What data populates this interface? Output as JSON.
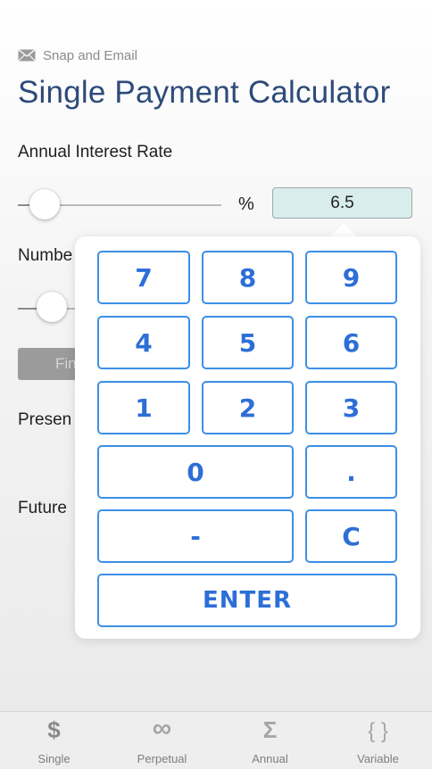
{
  "header": {
    "snap_email_label": "Snap and Email",
    "title": "Single Payment Calculator"
  },
  "interest": {
    "label": "Annual Interest Rate",
    "unit": "%",
    "value": "6.5"
  },
  "labels": {
    "number_partial": "Numbe",
    "button_partial": "Fin",
    "present_partial": "Presen",
    "future_partial": "Future"
  },
  "keypad": {
    "keys": [
      "7",
      "8",
      "9",
      "4",
      "5",
      "6",
      "1",
      "2",
      "3",
      "0",
      ".",
      "-",
      "C"
    ],
    "enter": "ENTER"
  },
  "tabs": [
    {
      "icon": "$",
      "label": "Single"
    },
    {
      "icon": "∞",
      "label": "Perpetual"
    },
    {
      "icon": "Σ",
      "label": "Annual"
    },
    {
      "icon": "{ }",
      "label": "Variable"
    }
  ],
  "colors": {
    "title": "#2e4a7a",
    "key_border": "#3d8fe6",
    "key_text": "#2d6fd6",
    "field_bg": "#d9eded"
  }
}
